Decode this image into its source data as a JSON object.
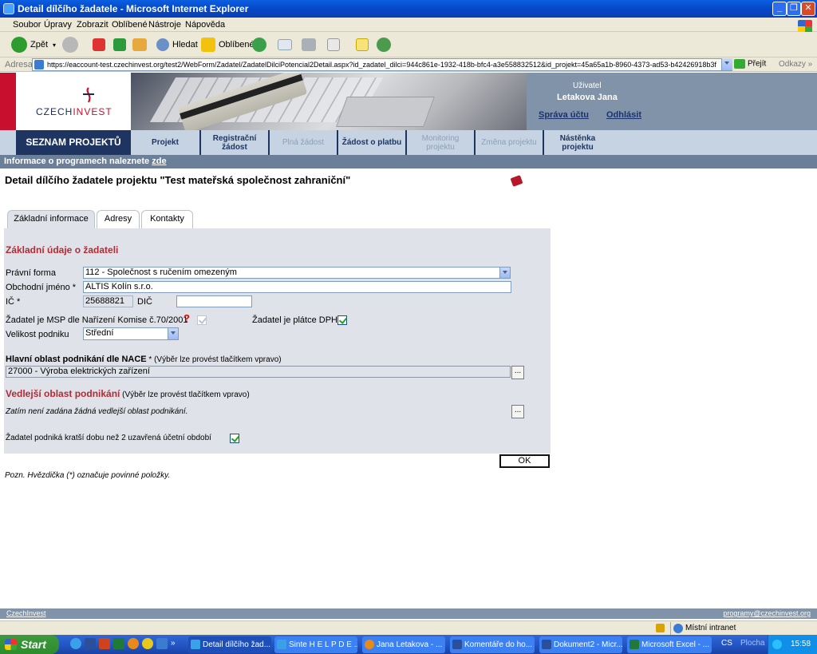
{
  "window": {
    "title": "Detail dílčího žadatele - Microsoft Internet Explorer"
  },
  "menu": [
    "Soubor",
    "Úpravy",
    "Zobrazit",
    "Oblíbené",
    "Nástroje",
    "Nápověda"
  ],
  "toolbar": {
    "back": "Zpět",
    "search": "Hledat",
    "favorites": "Oblíbené"
  },
  "address": {
    "label": "Adresa",
    "url": "https://eaccount-test.czechinvest.org/test2/WebForm/Zadatel/ZadatelDilciPotencial2Detail.aspx?id_zadatel_dilci=944c861e-1932-418b-bfc4-a3e558832512&id_projekt=45a65a1b-8960-4373-ad53-b42426918b3f",
    "go": "Přejít",
    "links": "Odkazy"
  },
  "header": {
    "logo_prefix": "CZECH",
    "logo_suffix": "INVEST",
    "user_label": "Uživatel",
    "user_name": "Letakova Jana",
    "account_link": "Správa účtu",
    "logout_link": "Odhlásit"
  },
  "nav": {
    "main": "SEZNAM PROJEKTŮ",
    "items": [
      {
        "label_1": "Projekt",
        "label_2": "",
        "enabled": true
      },
      {
        "label_1": "Registrační",
        "label_2": "žádost",
        "enabled": true
      },
      {
        "label_1": "Plná žádost",
        "label_2": "",
        "enabled": false
      },
      {
        "label_1": "Žádost o platbu",
        "label_2": "",
        "enabled": true
      },
      {
        "label_1": "Monitoring",
        "label_2": "projektu",
        "enabled": false
      },
      {
        "label_1": "Změna projektu",
        "label_2": "",
        "enabled": false
      },
      {
        "label_1": "Nástěnka",
        "label_2": "projektu",
        "enabled": true
      }
    ]
  },
  "info": {
    "text": "Informace o programech naleznete",
    "link": "zde"
  },
  "page": {
    "title": "Detail dílčího žadatele projektu  \"Test mateřská společnost zahraniční\""
  },
  "tabs": [
    "Základní informace",
    "Adresy",
    "Kontakty"
  ],
  "form": {
    "section_basic": "Základní údaje o žadateli",
    "legal_form_label": "Právní forma",
    "legal_form_value": "112 - Společnost s ručením omezeným",
    "business_name_label": "Obchodní jméno *",
    "business_name_value": "ALTIS Kolín s.r.o.",
    "ic_label": "IČ *",
    "ic_value": "25688821",
    "dic_label": "DIČ",
    "dic_value": "",
    "msp_label": "Žadatel je MSP dle Nařízení Komise č.70/2001",
    "msp_help": "?",
    "vat_label": "Žadatel je plátce DPH",
    "size_label": "Velikost podniku",
    "size_value": "Střední",
    "nace_label": "Hlavní oblast podnikání dle NACE",
    "nace_hint": " * (Výběr lze provést tlačítkem vpravo)",
    "nace_value": "27000 - Výroba elektrických zařízení",
    "secondary_label": "Vedlejší oblast podnikání",
    "secondary_hint": " (Výběr lze provést tlačítkem vpravo)",
    "secondary_empty": "Zatím není zadána žádná vedlejší oblast podnikání.",
    "short_label": "Žadatel podniká kratší dobu než 2 uzavřená účetní období",
    "dots": "...",
    "ok": "OK",
    "note": "Pozn. Hvězdička (*) označuje povinné položky."
  },
  "footer": {
    "left": "CzechInvest",
    "right": "programy@czechinvest.org"
  },
  "status": {
    "zone": "Místní intranet"
  },
  "taskbar": {
    "start": "Start",
    "tasks": [
      "Detail dílčího žad...",
      "Sinte H E L P D E ...",
      "Jana Letakova - ...",
      "Komentáře do ho...",
      "Dokument2 - Micr...",
      "Microsoft Excel - ..."
    ],
    "lang": "CS",
    "desktop": "Plocha",
    "clock": "15:58"
  }
}
